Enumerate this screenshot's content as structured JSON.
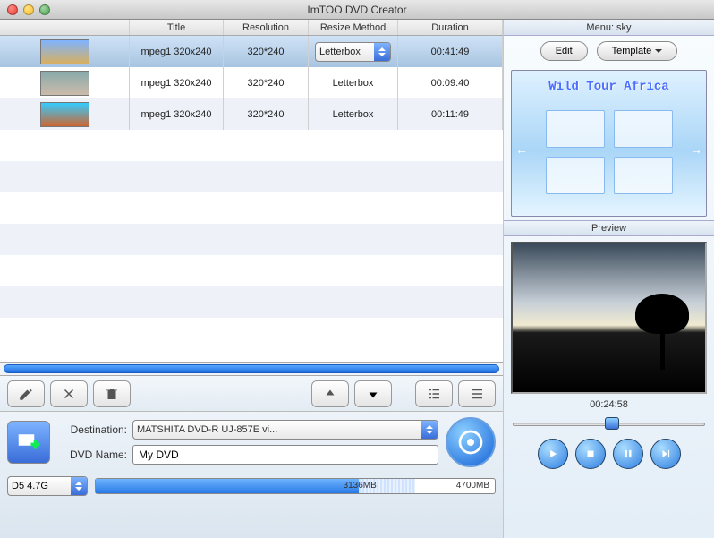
{
  "window": {
    "title": "ImTOO DVD Creator"
  },
  "columns": {
    "thumb": "",
    "title": "Title",
    "resolution": "Resolution",
    "method": "Resize Method",
    "duration": "Duration"
  },
  "rows": [
    {
      "title": "mpeg1 320x240",
      "resolution": "320*240",
      "method": "Letterbox",
      "duration": "00:41:49",
      "selected": true
    },
    {
      "title": "mpeg1 320x240",
      "resolution": "320*240",
      "method": "Letterbox",
      "duration": "00:09:40",
      "selected": false
    },
    {
      "title": "mpeg1 320x240",
      "resolution": "320*240",
      "method": "Letterbox",
      "duration": "00:11:49",
      "selected": false
    }
  ],
  "form": {
    "destination_label": "Destination:",
    "destination_value": "MATSHITA DVD-R   UJ-857E vi...",
    "dvdname_label": "DVD Name:",
    "dvdname_value": "My DVD"
  },
  "capacity": {
    "disc": "D5 4.7G",
    "used": "3136MB",
    "total": "4700MB"
  },
  "menu": {
    "header": "Menu:  sky",
    "edit": "Edit",
    "template": "Template",
    "title": "Wild Tour Africa"
  },
  "preview": {
    "header": "Preview",
    "time": "00:24:58"
  }
}
